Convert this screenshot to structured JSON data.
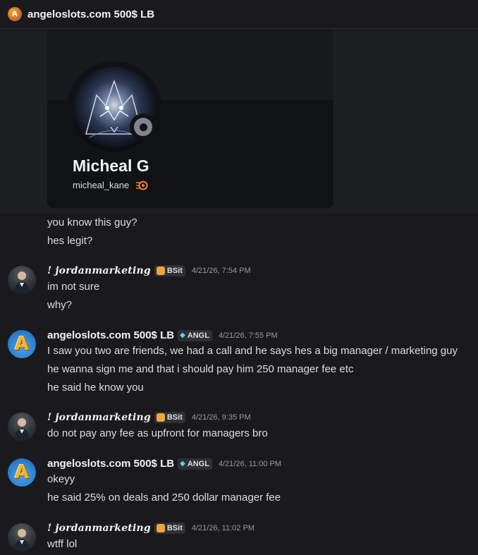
{
  "channel": {
    "title": "angeloslots.com 500$ LB",
    "icon": "server-avatar-icon",
    "icon_letter": "A"
  },
  "profile_card": {
    "display_name": "Micheal G",
    "username": "micheal_kane",
    "status": "offline",
    "badge_icon": "hypesquad-icon"
  },
  "continuation": [
    "you know this guy?",
    "hes legit?"
  ],
  "messages": [
    {
      "author": "! jordanmarketing",
      "tag": "BSit",
      "timestamp": "4/21/26, 7:54 PM",
      "lines": [
        "im not sure",
        "why?"
      ]
    },
    {
      "author": "angeloslots.com 500$ LB",
      "tag": "ANGL",
      "timestamp": "4/21/26, 7:55 PM",
      "lines": [
        "I saw you two are friends, we had a call and he says hes a big manager / marketing guy",
        "he wanna sign me and that i should pay him 250 manager fee etc",
        "he said he know you"
      ]
    },
    {
      "author": "! jordanmarketing",
      "tag": "BSit",
      "timestamp": "4/21/26, 9:35 PM",
      "lines": [
        "do not pay any fee as upfront for managers bro"
      ]
    },
    {
      "author": "angeloslots.com 500$ LB",
      "tag": "ANGL",
      "timestamp": "4/21/26, 11:00 PM",
      "lines": [
        "okeyy",
        "he said 25% on deals and 250 dollar manager fee"
      ]
    },
    {
      "author": "! jordanmarketing",
      "tag": "BSit",
      "timestamp": "4/21/26, 11:02 PM",
      "lines": [
        "wtff lol"
      ]
    }
  ]
}
